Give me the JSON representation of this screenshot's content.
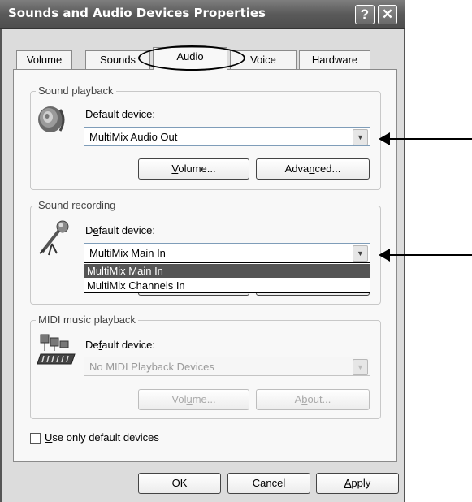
{
  "window": {
    "title": "Sounds and Audio Devices Properties",
    "help_glyph": "?",
    "close_glyph": "✕"
  },
  "tabs": [
    {
      "label": "Volume"
    },
    {
      "label": "Sounds"
    },
    {
      "label": "Audio",
      "active": true
    },
    {
      "label": "Voice"
    },
    {
      "label": "Hardware"
    }
  ],
  "playback": {
    "group_label": "Sound playback",
    "device_label_first": "D",
    "device_label_rest": "efault device:",
    "selected_value": "MultiMix Audio Out",
    "volume_button": {
      "pre": "",
      "key": "V",
      "post": "olume..."
    },
    "advanced_button": {
      "pre": "Adva",
      "key": "n",
      "post": "ced..."
    }
  },
  "recording": {
    "group_label": "Sound recording",
    "device_label_pre": "D",
    "device_label_key": "e",
    "device_label_post": "fault device:",
    "selected_value": "MultiMix Main In",
    "options": [
      "MultiMix Main In",
      "MultiMix Channels In"
    ]
  },
  "midi": {
    "group_label": "MIDI music playback",
    "device_label_pre": "De",
    "device_label_key": "f",
    "device_label_post": "ault device:",
    "selected_value": "No MIDI Playback Devices",
    "volume_button": {
      "pre": "Vol",
      "key": "u",
      "post": "me..."
    },
    "about_button": {
      "pre": "A",
      "key": "b",
      "post": "out..."
    }
  },
  "use_default": {
    "key": "U",
    "rest": "se only default devices",
    "checked": false
  },
  "footer": {
    "ok_label": "OK",
    "cancel_label": "Cancel",
    "apply_key": "A",
    "apply_rest": "pply"
  },
  "icons": {
    "speaker": "speaker-icon",
    "microphone": "microphone-icon",
    "midi": "midi-keyboard-icon"
  }
}
